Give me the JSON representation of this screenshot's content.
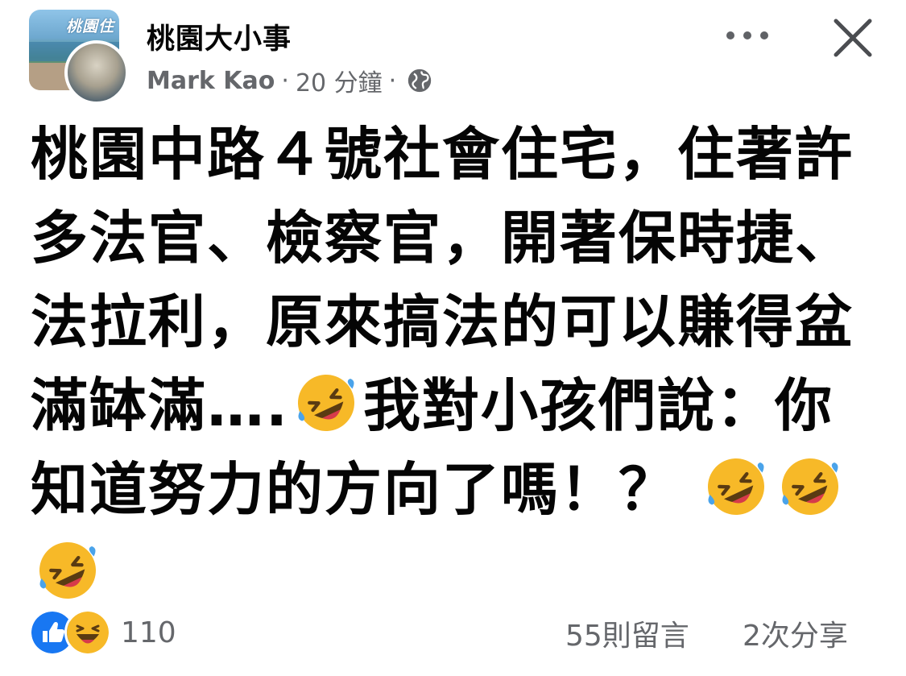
{
  "header": {
    "page_name": "桃園大小事",
    "page_avatar_text": "桃園住",
    "author": "Mark Kao",
    "separator": "·",
    "time_ago": "20 分鐘"
  },
  "icons": {
    "more": "more-options-icon",
    "close": "close-icon",
    "audience": "globe-icon",
    "emoji": "rolling-on-floor-laughing-emoji",
    "like": "like-reaction-icon",
    "haha": "haha-reaction-icon"
  },
  "post": {
    "text_part1": "桃園中路４號社會住宅，住著許多法官、檢察官，開著保時捷、法拉利，原來搞法的可以賺得盆滿缽滿….",
    "text_part2": "我對小孩們說：你知道努力的方向了嗎！？ "
  },
  "footer": {
    "reaction_count": "110",
    "comments": "55則留言",
    "shares": "2次分享"
  },
  "colors": {
    "text": "#050505",
    "secondary": "#65676b",
    "like_blue": "#1877f2",
    "haha_yellow": "#f7b928"
  }
}
